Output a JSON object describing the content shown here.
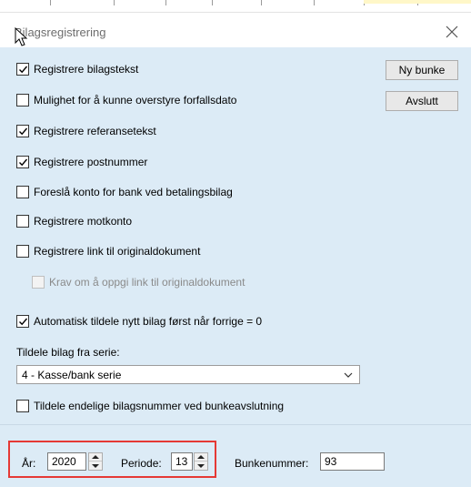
{
  "window": {
    "title": "Bilagsregistrering",
    "close_icon": "close-icon"
  },
  "buttons": {
    "ny_bunke": "Ny bunke",
    "avslutt": "Avslutt"
  },
  "options": [
    {
      "label": "Registrere bilagstekst",
      "checked": true,
      "enabled": true
    },
    {
      "label": "Mulighet for å kunne overstyre forfallsdato",
      "checked": false,
      "enabled": true
    },
    {
      "label": "Registrere referansetekst",
      "checked": true,
      "enabled": true
    },
    {
      "label": "Registrere postnummer",
      "checked": true,
      "enabled": true
    },
    {
      "label": "Foreslå konto for bank ved betalingsbilag",
      "checked": false,
      "enabled": true
    },
    {
      "label": "Registrere motkonto",
      "checked": false,
      "enabled": true
    },
    {
      "label": "Registrere link til originaldokument",
      "checked": false,
      "enabled": true
    },
    {
      "label": "Krav om å oppgi link til originaldokument",
      "checked": false,
      "enabled": false
    },
    {
      "label": "Automatisk tildele nytt bilag først når forrige = 0",
      "checked": true,
      "enabled": true
    }
  ],
  "series": {
    "label": "Tildele bilag fra serie:",
    "selected": "4 - Kasse/bank serie"
  },
  "final_numbers": {
    "label": "Tildele endelige bilagsnummer ved bunkeavslutning",
    "checked": false
  },
  "fields": {
    "year_label": "År:",
    "year_value": "2020",
    "period_label": "Periode:",
    "period_value": "13",
    "batch_label": "Bunkenummer:",
    "batch_value": "93"
  },
  "colors": {
    "panel": "#dcebf6",
    "highlight": "#e53935"
  }
}
